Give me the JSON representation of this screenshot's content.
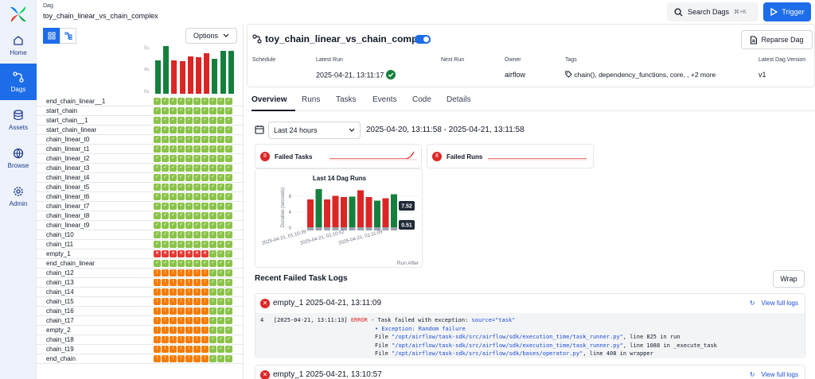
{
  "nav": {
    "items": [
      {
        "label": "Home",
        "icon": "home-icon"
      },
      {
        "label": "Dags",
        "icon": "dags-icon"
      },
      {
        "label": "Assets",
        "icon": "assets-icon"
      },
      {
        "label": "Browse",
        "icon": "globe-icon"
      },
      {
        "label": "Admin",
        "icon": "gear-icon"
      }
    ],
    "active": "Dags"
  },
  "topbar": {
    "dag_label": "Dag",
    "dag_name": "toy_chain_linear_vs_chain_complex",
    "search_label": "Search Dags",
    "search_shortcut": "⌘+K",
    "trigger_label": "Trigger"
  },
  "grid": {
    "options_label": "Options",
    "axis": [
      "5s",
      "4s",
      "0s"
    ],
    "run_bars": [
      {
        "value": 4.6,
        "state": "success"
      },
      {
        "value": 6.5,
        "state": "success"
      },
      {
        "value": 4.5,
        "state": "failed"
      },
      {
        "value": 4.4,
        "state": "failed"
      },
      {
        "value": 5.1,
        "state": "failed"
      },
      {
        "value": 5.0,
        "state": "failed"
      },
      {
        "value": 5.5,
        "state": "failed"
      },
      {
        "value": 4.8,
        "state": "success"
      },
      {
        "value": 5.8,
        "state": "success"
      },
      {
        "value": 5.8,
        "state": "success"
      }
    ],
    "tasks": [
      {
        "name": "end_chain_linear__1",
        "cells": "ssssssssss"
      },
      {
        "name": "start_chain",
        "cells": "ssssssssss"
      },
      {
        "name": "start_chain__1",
        "cells": "ssssssssss"
      },
      {
        "name": "start_chain_linear",
        "cells": "ssssssssss"
      },
      {
        "name": "chain_linear_t0",
        "cells": "ssssssssss"
      },
      {
        "name": "chain_linear_t1",
        "cells": "ssssssssss"
      },
      {
        "name": "chain_linear_t2",
        "cells": "ssssssssss"
      },
      {
        "name": "chain_linear_t3",
        "cells": "ssssssssss"
      },
      {
        "name": "chain_linear_t4",
        "cells": "ssssssssss"
      },
      {
        "name": "chain_linear_t5",
        "cells": "ssssssssss"
      },
      {
        "name": "chain_linear_t6",
        "cells": "ssssssssss"
      },
      {
        "name": "chain_linear_t7",
        "cells": "ssssssssss"
      },
      {
        "name": "chain_linear_t8",
        "cells": "ssssssssss"
      },
      {
        "name": "chain_linear_t9",
        "cells": "ssssssssss"
      },
      {
        "name": "chain_t10",
        "cells": "ssssssssss"
      },
      {
        "name": "chain_t11",
        "cells": "ssssssssss"
      },
      {
        "name": "empty_1",
        "cells": "fffffffsss"
      },
      {
        "name": "end_chain_linear",
        "cells": "ssssssssss"
      },
      {
        "name": "chain_t12",
        "cells": "uuuuuuusss"
      },
      {
        "name": "chain_t13",
        "cells": "uuuuuuusss"
      },
      {
        "name": "chain_t14",
        "cells": "uuuuuuusss"
      },
      {
        "name": "chain_t15",
        "cells": "uuuuuuusss"
      },
      {
        "name": "chain_t16",
        "cells": "uuuuuuusss"
      },
      {
        "name": "chain_t17",
        "cells": "uuuuuuusss"
      },
      {
        "name": "empty_2",
        "cells": "uuuuuuusss"
      },
      {
        "name": "chain_t18",
        "cells": "uuuuuuusss"
      },
      {
        "name": "chain_t19",
        "cells": "uuuuuuusss"
      },
      {
        "name": "end_chain",
        "cells": "uuuuuuusss"
      }
    ]
  },
  "header": {
    "title": "toy_chain_linear_vs_chain_complex",
    "reparse_label": "Reparse Dag",
    "schedule_label": "Schedule",
    "latest_run_label": "Latest Run",
    "latest_run_value": "2025-04-21, 13:11:17",
    "next_run_label": "Next Run",
    "owner_label": "Owner",
    "owner_value": "airflow",
    "tags_label": "Tags",
    "tags_value": "chain(), dependency_functions, core, , +2 more",
    "version_label": "Latest Dag Version",
    "version_value": "v1"
  },
  "tabs": [
    "Overview",
    "Runs",
    "Tasks",
    "Events",
    "Code",
    "Details"
  ],
  "overview": {
    "range_select": "Last 24 hours",
    "range_text": "2025-04-20, 13:11:58 - 2025-04-21, 13:11:58",
    "failed_tasks_count": "8",
    "failed_tasks_label": "Failed Tasks",
    "failed_runs_count": "8",
    "failed_runs_label": "Failed Runs",
    "runs_chart_title": "Last 14 Dag Runs",
    "runs_chart_ylabel": "Duration (seconds)",
    "runs_chart_xlabel": "Run After",
    "runs_chart_ticks": [
      "8",
      "4",
      "0"
    ],
    "runs_chart_xticks": [
      "2025-04-21, 01:10:39",
      "2025-04-21, 01:10:52",
      "2025-04-21, 01:11:09"
    ],
    "tooltip_top": "7.52",
    "tooltip_bottom": "0.51",
    "recent_failed_title": "Recent Failed Task Logs",
    "wrap_label": "Wrap",
    "view_full_logs": "View full logs"
  },
  "chart_data": {
    "type": "bar",
    "title": "Last 14 Dag Runs",
    "xlabel": "Run After",
    "ylabel": "Duration (seconds)",
    "ylim": [
      0,
      10
    ],
    "categories": [
      "2025-04-21, 01:10:39",
      "",
      "",
      "",
      "2025-04-21, 01:10:52",
      "",
      "",
      "",
      "2025-04-21, 01:11:09",
      "",
      ""
    ],
    "values": [
      7.2,
      9.8,
      7.2,
      8.1,
      7.8,
      7.9,
      9.5,
      7.8,
      6.9,
      7.5,
      8.5
    ],
    "states": [
      "failed",
      "success",
      "failed",
      "failed",
      "failed",
      "success",
      "failed",
      "failed",
      "success",
      "failed",
      "success"
    ],
    "queued_values": [
      0.5,
      0.5,
      0.5,
      0.5,
      0.5,
      0.5,
      0.5,
      0.5,
      0.5,
      0.5,
      0.51
    ],
    "grid": true
  },
  "logs": [
    {
      "task": "empty_1 2025-04-21, 13:11:09",
      "line_no": "4",
      "timestamp": "[2025-04-21, 13:11:13]",
      "level": "ERROR",
      "message": "- Task failed with exception:",
      "source": "source=\"task\"",
      "exception": "• Exception: Random failure",
      "frames": [
        {
          "path": "\"/opt/airflow/task-sdk/src/airflow/sdk/execution_time/task_runner.py\"",
          "rest": ", line 825 in run"
        },
        {
          "path": "\"/opt/airflow/task-sdk/src/airflow/sdk/execution_time/task_runner.py\"",
          "rest": ", line 1088 in _execute_task"
        },
        {
          "path": "\"/opt/airflow/task-sdk/src/airflow/sdk/bases/operator.py\"",
          "rest": ", line 408 in wrapper"
        }
      ]
    },
    {
      "task": "empty_1 2025-04-21, 13:10:57"
    }
  ],
  "colors": {
    "primary": "#1d6ce8",
    "success": "#15803d",
    "failed": "#dc2626",
    "upstream_failed": "#f57c00"
  }
}
